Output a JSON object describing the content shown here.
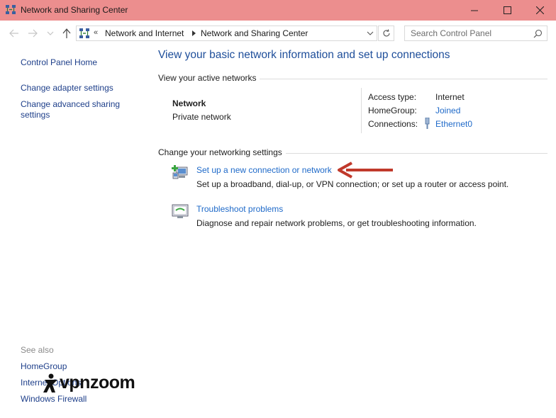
{
  "window": {
    "title": "Network and Sharing Center"
  },
  "navbar": {
    "breadcrumb_prefix": "«",
    "breadcrumb": [
      "Network and Internet",
      "Network and Sharing Center"
    ],
    "search_placeholder": "Search Control Panel"
  },
  "left_nav": {
    "items": [
      "Control Panel Home",
      "Change adapter settings",
      "Change advanced sharing",
      "settings"
    ]
  },
  "see_also": {
    "header": "See also",
    "items": [
      "HomeGroup",
      "Internet Options",
      "Windows Firewall"
    ]
  },
  "main": {
    "title": "View your basic network information and set up connections",
    "active_networks_header": "View your active networks",
    "network": {
      "name": "Network",
      "type": "Private network"
    },
    "access": {
      "access_type_label": "Access type:",
      "access_type_value": "Internet",
      "homegroup_label": "HomeGroup:",
      "homegroup_value": "Joined",
      "connections_label": "Connections:",
      "connections_value": "Ethernet0"
    },
    "change_settings_header": "Change your networking settings",
    "tasks": [
      {
        "link": "Set up a new connection or network",
        "desc": "Set up a broadband, dial-up, or VPN connection; or set up a router or access point."
      },
      {
        "link": "Troubleshoot problems",
        "desc": "Diagnose and repair network problems, or get troubleshooting information."
      }
    ]
  },
  "annotation": {
    "arrow_color": "#c0392b"
  },
  "watermark": {
    "text": "vpnzoom"
  },
  "colors": {
    "titlebar": "#ec8e8e",
    "link": "#1f6ac9",
    "title": "#1e4e9a"
  }
}
